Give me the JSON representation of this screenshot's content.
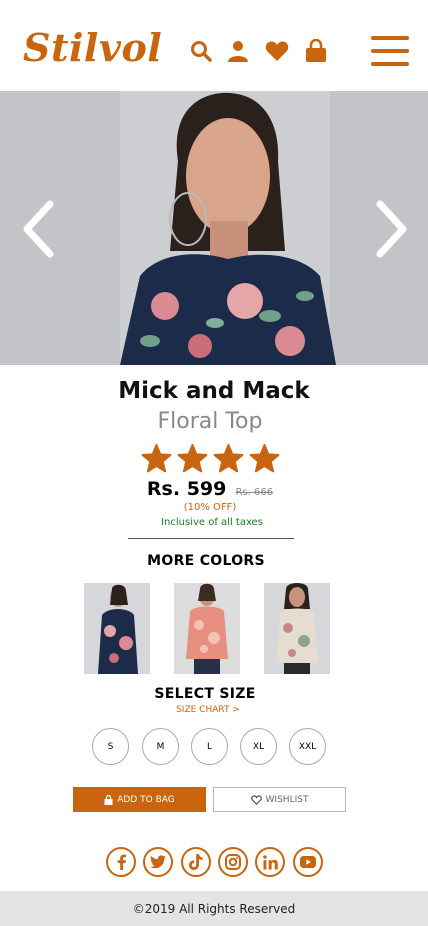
{
  "brand": {
    "logo_text": "Stilvol",
    "accent_color": "#c9650e"
  },
  "header": {
    "icons": [
      "search-icon",
      "user-icon",
      "heart-icon",
      "shopping-bag-icon"
    ],
    "menu_icon": "hamburger-menu-icon"
  },
  "product": {
    "name": "Mick and Mack",
    "type": "Floral Top",
    "rating_stars": 4,
    "price": "Rs. 599",
    "original_price": "Rs. 666",
    "discount": "(10% OFF)",
    "tax_note": "Inclusive of all taxes"
  },
  "colors": {
    "heading": "MORE COLORS",
    "swatches": [
      "navy-floral",
      "coral-floral",
      "beige-floral"
    ]
  },
  "sizes": {
    "heading": "SELECT SIZE",
    "chart_link": "SIZE CHART >",
    "options": [
      "S",
      "M",
      "L",
      "XL",
      "XXL"
    ]
  },
  "actions": {
    "add_to_bag": "ADD TO BAG",
    "wishlist": "WISHLIST"
  },
  "social": [
    "facebook-icon",
    "twitter-icon",
    "tiktok-icon",
    "instagram-icon",
    "linkedin-icon",
    "youtube-icon"
  ],
  "footer": {
    "copyright": "©2019 All Rights Reserved"
  }
}
